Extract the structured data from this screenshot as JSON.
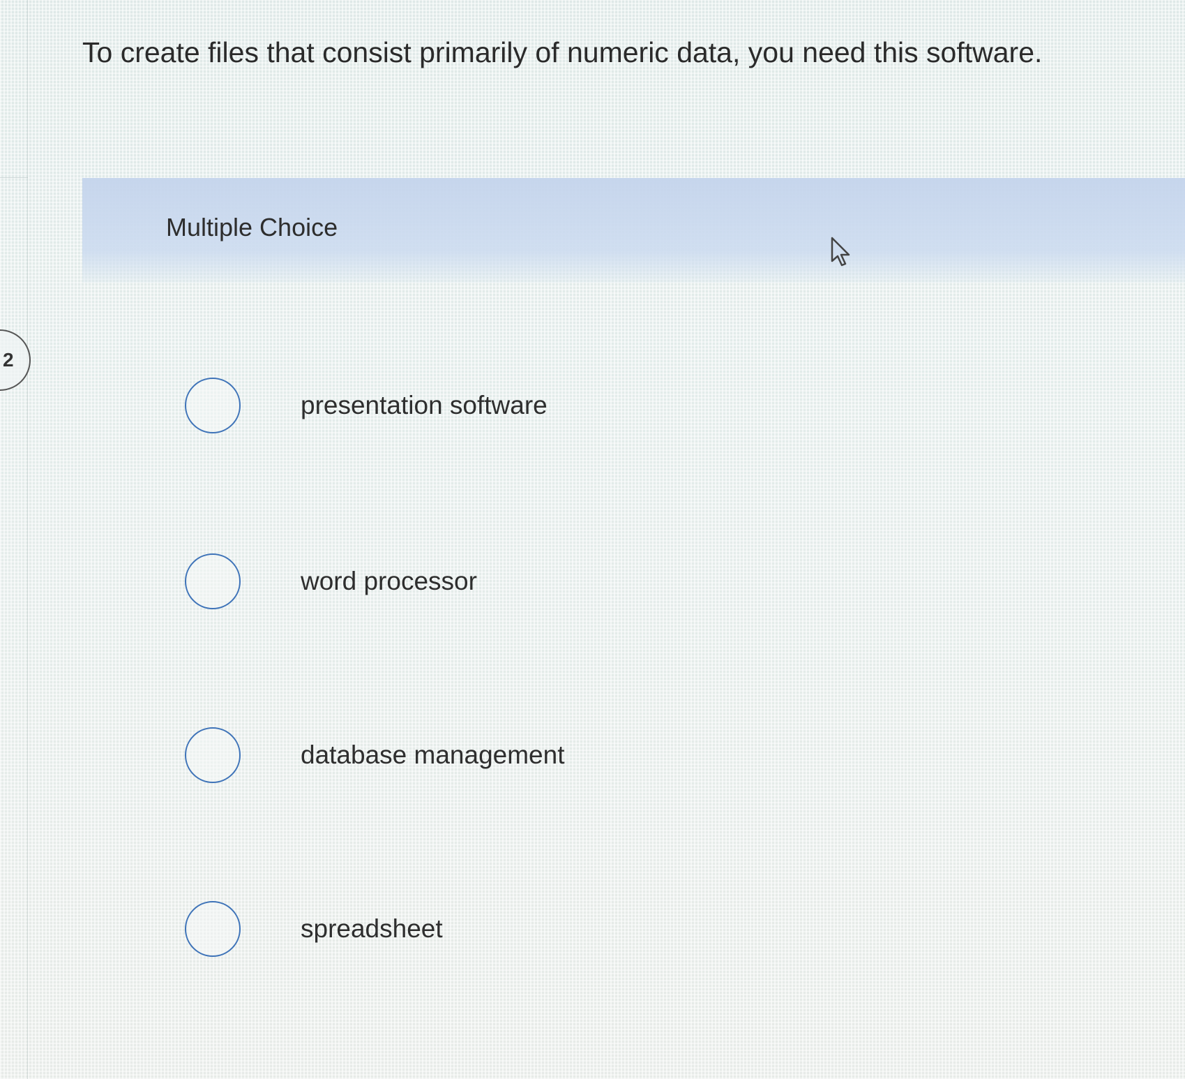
{
  "question": {
    "number": "2",
    "text": "To create files that consist primarily of numeric data, you need this software."
  },
  "section": {
    "label": "Multiple Choice"
  },
  "options": [
    {
      "label": "presentation software",
      "selected": false
    },
    {
      "label": "word processor",
      "selected": false
    },
    {
      "label": "database management",
      "selected": false
    },
    {
      "label": "spreadsheet",
      "selected": false
    }
  ],
  "icons": {
    "cursor": "mouse-pointer-icon",
    "radio": "radio-circle-icon"
  },
  "colors": {
    "radio_border": "#3e73b8",
    "banner": "#c8d8ee"
  }
}
